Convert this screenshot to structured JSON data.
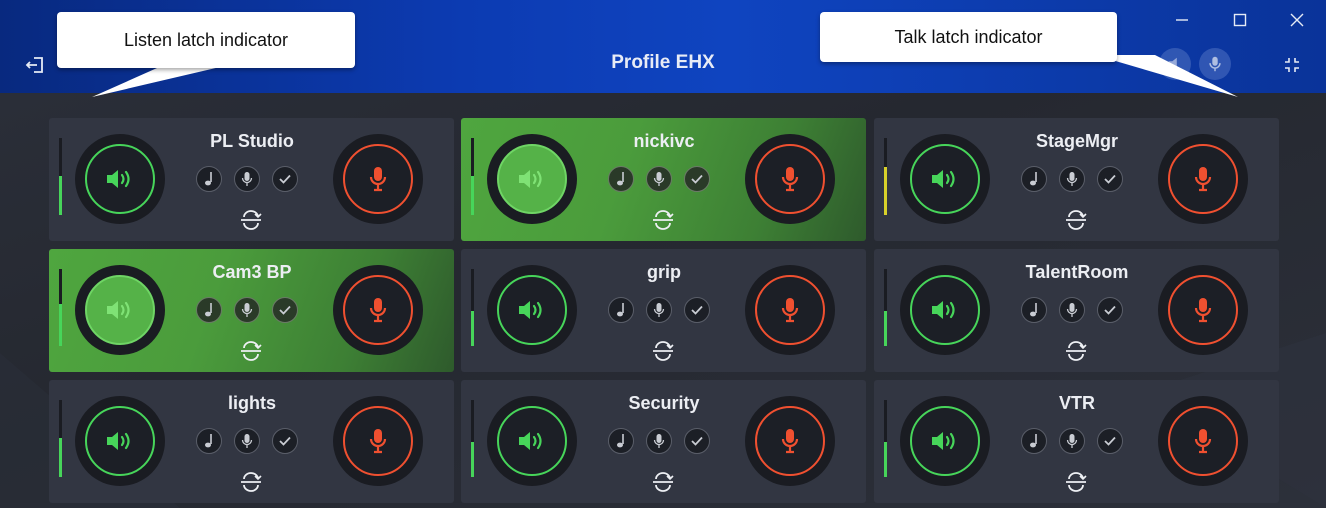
{
  "header": {
    "title": "Profile EHX",
    "exit_icon": "exit-icon",
    "collapse_icon": "collapse-icon",
    "minimize_icon": "minimize-icon",
    "maximize_icon": "maximize-icon",
    "close_icon": "close-icon",
    "speaker_icon": "speaker-icon",
    "mic_icon": "mic-icon"
  },
  "callouts": {
    "listen": "Listen latch indicator",
    "talk": "Talk latch indicator"
  },
  "colors": {
    "listen": "#47d55a",
    "talk": "#f05030",
    "active_card": "#4b9c3c",
    "meter_yellow": "#d8d12a"
  },
  "channels": [
    {
      "name": "PL Studio",
      "active": false,
      "meter_level": 0.5
    },
    {
      "name": "nickivc",
      "active": true,
      "meter_level": 0.5
    },
    {
      "name": "StageMgr",
      "active": false,
      "meter_level": 0.62
    },
    {
      "name": "Cam3 BP",
      "active": true,
      "meter_level": 0.55
    },
    {
      "name": "grip",
      "active": false,
      "meter_level": 0.45
    },
    {
      "name": "TalentRoom",
      "active": false,
      "meter_level": 0.45
    },
    {
      "name": "lights",
      "active": false,
      "meter_level": 0.5
    },
    {
      "name": "Security",
      "active": false,
      "meter_level": 0.45
    },
    {
      "name": "VTR",
      "active": false,
      "meter_level": 0.45
    }
  ],
  "card_icons": [
    "music-note-icon",
    "mic-icon",
    "check-icon",
    "route-icon"
  ]
}
